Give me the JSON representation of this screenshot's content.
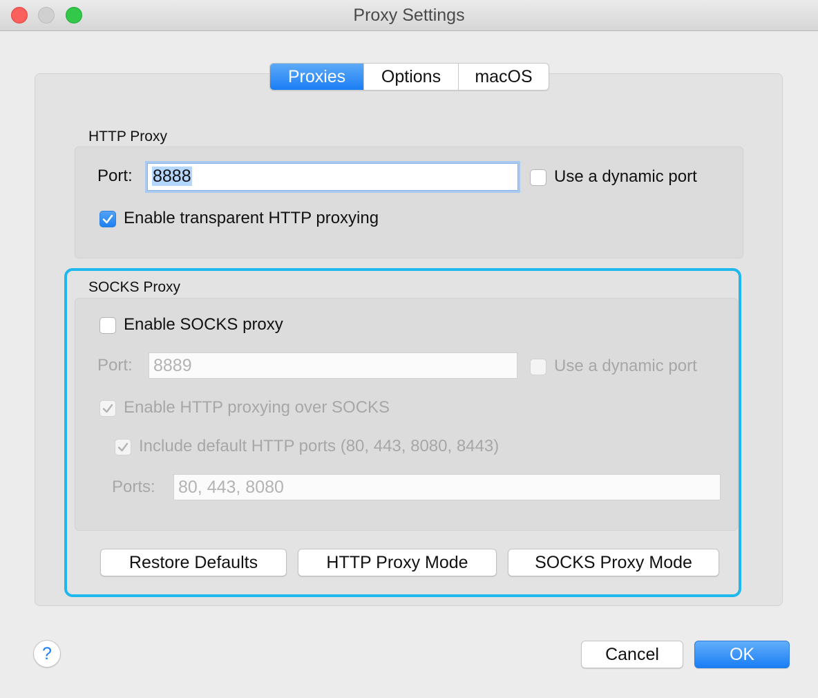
{
  "window": {
    "title": "Proxy Settings"
  },
  "tabs": [
    {
      "label": "Proxies",
      "active": true
    },
    {
      "label": "Options",
      "active": false
    },
    {
      "label": "macOS",
      "active": false
    }
  ],
  "http_proxy": {
    "group_label": "HTTP Proxy",
    "port_label": "Port:",
    "port_value": "8888",
    "dynamic_port_label": "Use a dynamic port",
    "dynamic_port_checked": false,
    "transparent_label": "Enable transparent HTTP proxying",
    "transparent_checked": true
  },
  "socks_proxy": {
    "group_label": "SOCKS Proxy",
    "enable_label": "Enable SOCKS proxy",
    "enable_checked": false,
    "port_label": "Port:",
    "port_value": "8889",
    "dynamic_port_label": "Use a dynamic port",
    "http_over_socks_label": "Enable HTTP proxying over SOCKS",
    "http_over_socks_checked": true,
    "include_ports_label": "Include default HTTP ports (80, 443, 8080, 8443)",
    "include_ports_checked": true,
    "ports_label": "Ports:",
    "ports_value": "80, 443, 8080"
  },
  "buttons": {
    "restore_defaults": "Restore Defaults",
    "http_proxy_mode": "HTTP Proxy Mode",
    "socks_proxy_mode": "SOCKS Proxy Mode",
    "cancel": "Cancel",
    "ok": "OK",
    "help": "?"
  },
  "colors": {
    "accent": "#1a7ef5",
    "highlight_frame": "#1fb8ec",
    "selection": "#b3d7ff"
  }
}
